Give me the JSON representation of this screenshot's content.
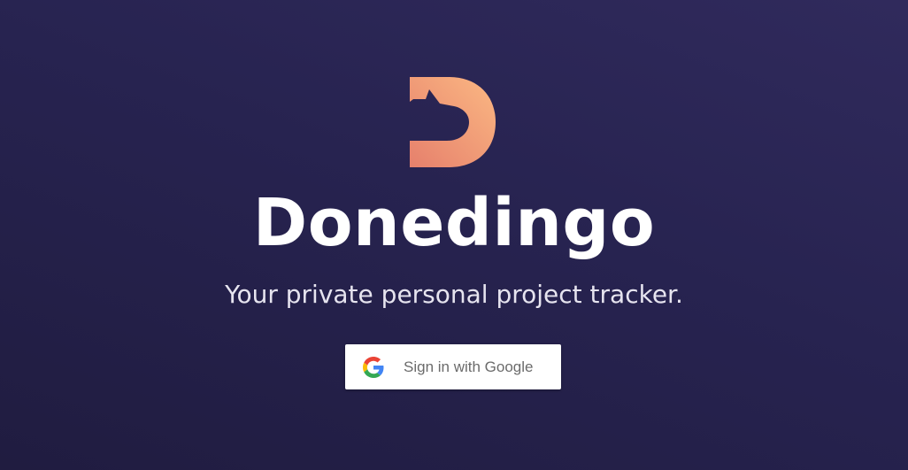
{
  "brand": {
    "name": "Donedingo",
    "tagline": "Your private personal project tracker.",
    "logo_icon": "dingo-head-d-logo",
    "accent_start": "#f9b27f",
    "accent_end": "#e9866f",
    "background": "#272350"
  },
  "auth": {
    "google_button_label": "Sign in with Google",
    "google_icon": "google-g-icon"
  }
}
